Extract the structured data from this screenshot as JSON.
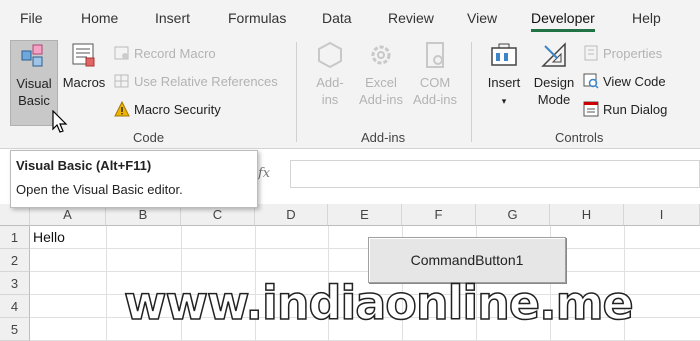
{
  "tabs": [
    "File",
    "Home",
    "Insert",
    "Formulas",
    "Data",
    "Review",
    "View",
    "Developer",
    "Help"
  ],
  "active_tab": "Developer",
  "ribbon": {
    "code": {
      "visual_basic_l1": "Visual",
      "visual_basic_l2": "Basic",
      "macros": "Macros",
      "record_macro": "Record Macro",
      "relative_refs": "Use Relative References",
      "macro_security": "Macro Security",
      "label": "Code"
    },
    "addins": {
      "addins_l1": "Add-",
      "addins_l2": "ins",
      "excel_l1": "Excel",
      "excel_l2": "Add-ins",
      "com_l1": "COM",
      "com_l2": "Add-ins",
      "label": "Add-ins"
    },
    "controls": {
      "insert": "Insert",
      "design_l1": "Design",
      "design_l2": "Mode",
      "properties": "Properties",
      "view_code": "View Code",
      "run_dialog": "Run Dialog",
      "label": "Controls"
    }
  },
  "formula_bar": {
    "fx": "fx"
  },
  "tooltip": {
    "title": "Visual Basic (Alt+F11)",
    "text": "Open the Visual Basic editor."
  },
  "columns": [
    "A",
    "B",
    "C",
    "D",
    "E",
    "F",
    "G",
    "H",
    "I"
  ],
  "rows": [
    "1",
    "2",
    "3",
    "4",
    "5"
  ],
  "cells": {
    "A1": "Hello"
  },
  "command_button": "CommandButton1",
  "watermark": "www.indiaonline.me",
  "colors": {
    "accent": "#217346",
    "warning": "#f0b400"
  }
}
